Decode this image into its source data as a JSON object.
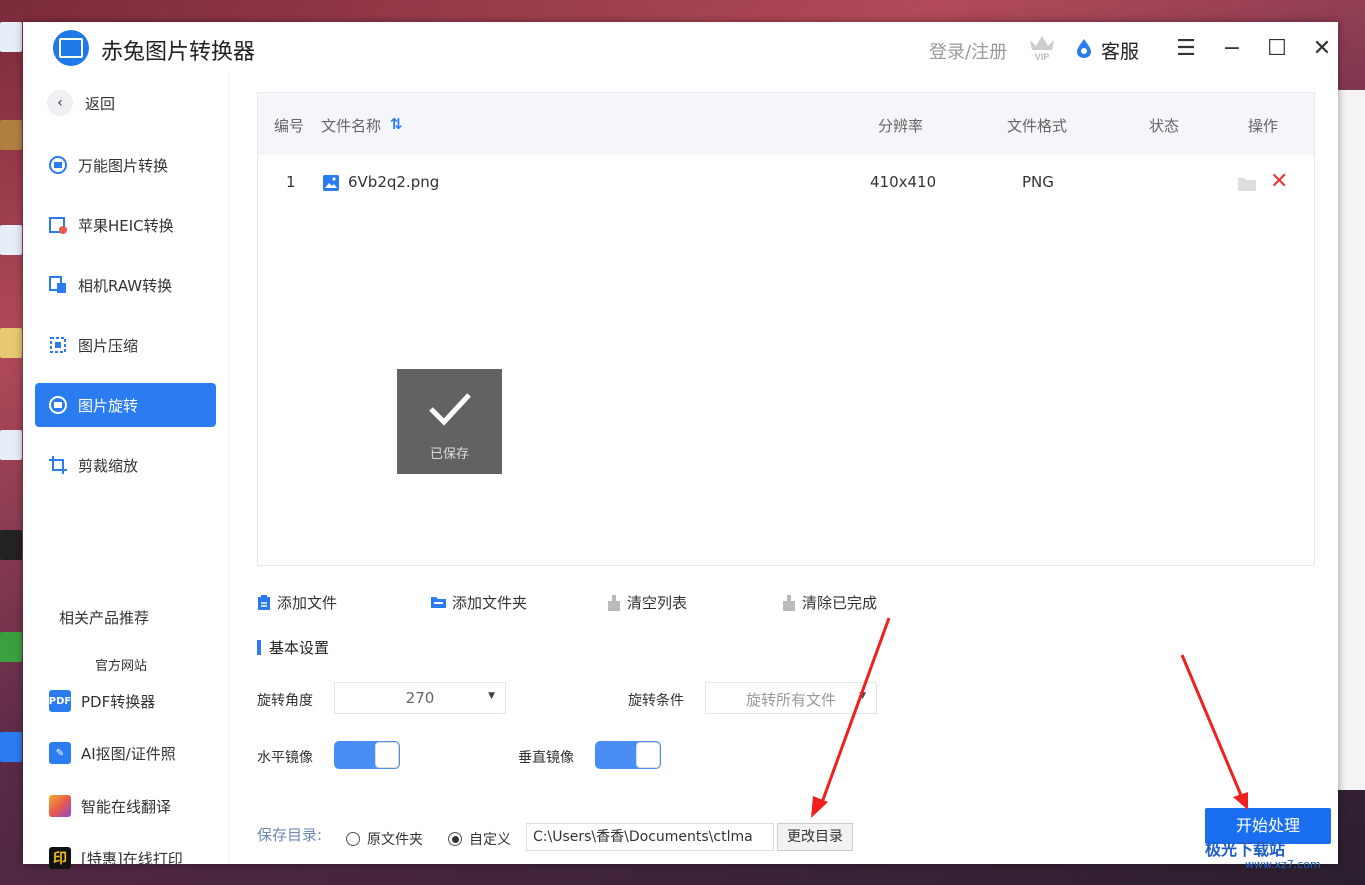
{
  "app": {
    "title": "赤兔图片转换器",
    "login": "登录/注册",
    "service": "客服"
  },
  "sidebar": {
    "back": "返回",
    "items": [
      {
        "label": "万能图片转换",
        "active": false
      },
      {
        "label": "苹果HEIC转换",
        "active": false
      },
      {
        "label": "相机RAW转换",
        "active": false
      },
      {
        "label": "图片压缩",
        "active": false
      },
      {
        "label": "图片旋转",
        "active": true
      },
      {
        "label": "剪裁缩放",
        "active": false
      }
    ],
    "recommend_title": "相关产品推荐",
    "official_site": "官方网站",
    "products": [
      {
        "label": "PDF转换器",
        "icon": "pdf-icon",
        "badge": "PDF",
        "color": "#2a7cf0"
      },
      {
        "label": "AI抠图/证件照",
        "icon": "ai-cutout-icon",
        "badge": "",
        "color": "#2a7cf0"
      },
      {
        "label": "智能在线翻译",
        "icon": "translate-icon",
        "badge": "",
        "color": "#e85a4a"
      },
      {
        "label": "[特惠]在线打印",
        "icon": "print-icon",
        "badge": "印",
        "color": "#111111"
      }
    ]
  },
  "table": {
    "headers": {
      "index": "编号",
      "name": "文件名称",
      "resolution": "分辨率",
      "format": "文件格式",
      "status": "状态",
      "action": "操作"
    },
    "rows": [
      {
        "index": "1",
        "name": "6Vb2q2.png",
        "resolution": "410x410",
        "format": "PNG",
        "status": ""
      }
    ]
  },
  "toast": {
    "text": "已保存"
  },
  "actions": {
    "add_file": "添加文件",
    "add_folder": "添加文件夹",
    "clear_list": "清空列表",
    "clear_done": "清除已完成"
  },
  "settings": {
    "title": "基本设置",
    "rotate_angle_label": "旋转角度",
    "rotate_angle_value": "270",
    "rotate_condition_label": "旋转条件",
    "rotate_condition_value": "旋转所有文件",
    "h_mirror_label": "水平镜像",
    "v_mirror_label": "垂直镜像",
    "h_mirror_on": true,
    "v_mirror_on": true
  },
  "output": {
    "save_dir_label": "保存目录:",
    "option_original": "原文件夹",
    "option_custom": "自定义",
    "selected": "custom",
    "path": "C:\\Users\\香香\\Documents\\ctlma",
    "change_dir": "更改目录"
  },
  "start_button": "开始处理",
  "watermark": {
    "brand": "极光下载站",
    "url": "www.xz7.com"
  },
  "colors": {
    "accent": "#2a7cf0",
    "start_button": "#1a6ff0",
    "delete": "#e83a3a"
  }
}
